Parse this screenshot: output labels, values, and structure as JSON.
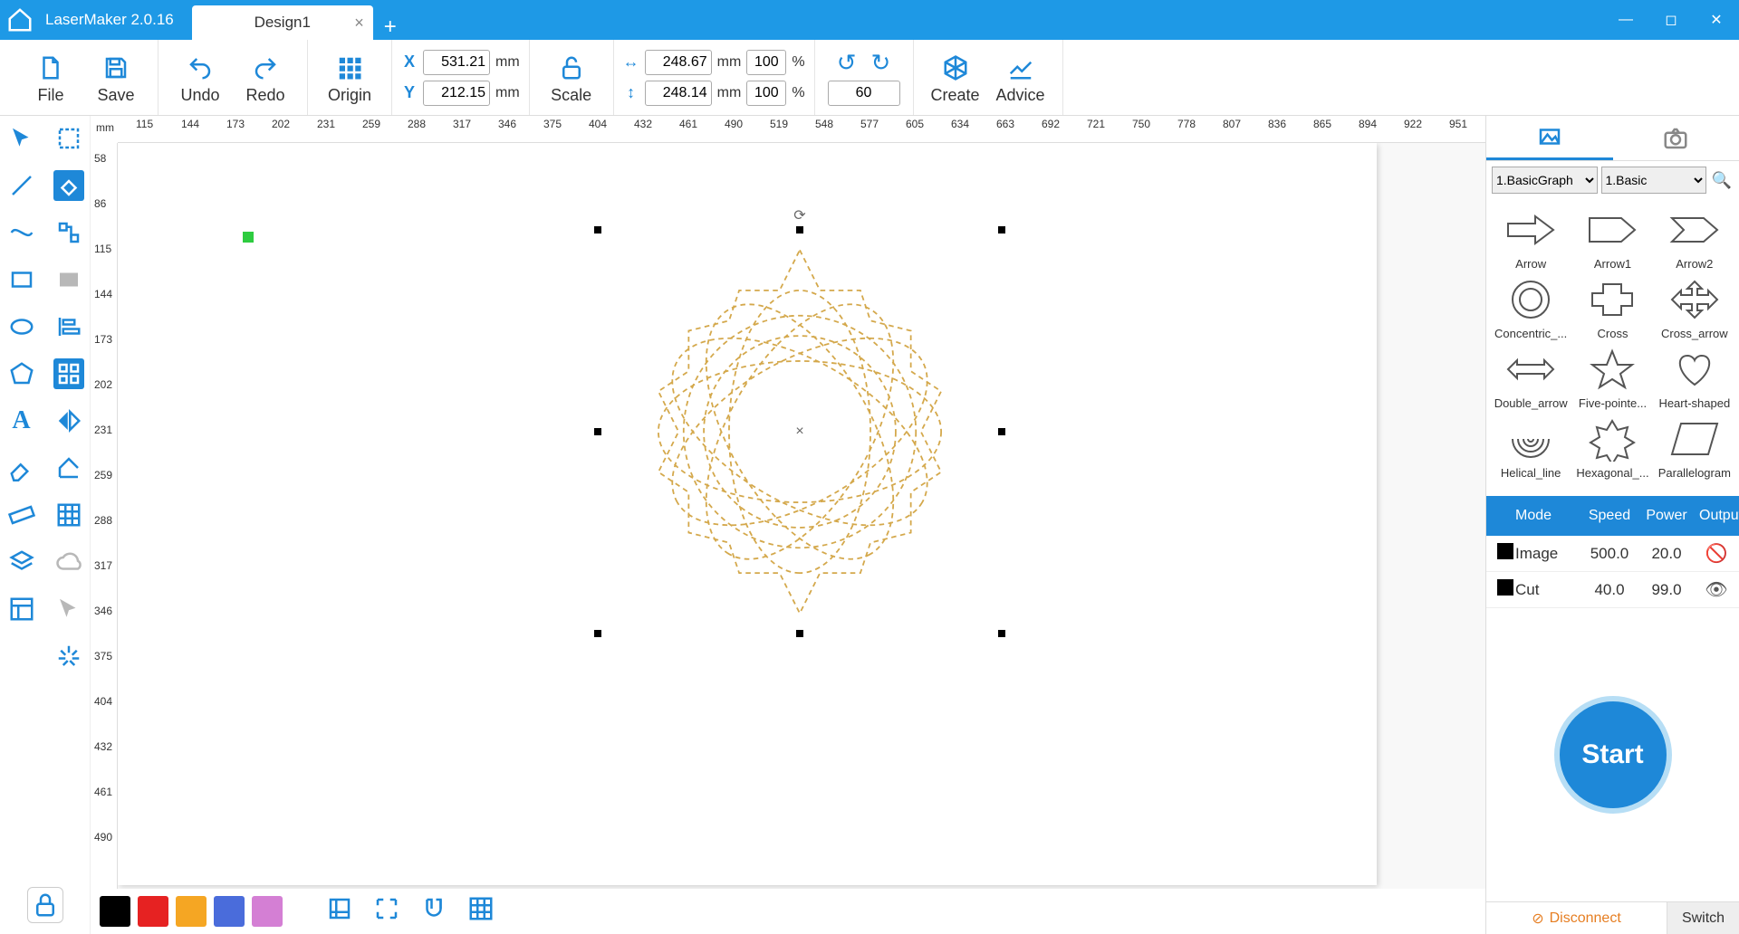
{
  "app": {
    "name": "LaserMaker 2.0.16",
    "tab": "Design1"
  },
  "toolbar": {
    "file": "File",
    "save": "Save",
    "undo": "Undo",
    "redo": "Redo",
    "origin": "Origin",
    "scale": "Scale",
    "create": "Create",
    "advice": "Advice",
    "x": "531.21",
    "y": "212.15",
    "w": "248.67",
    "h": "248.14",
    "sx": "100",
    "sy": "100",
    "rot": "60",
    "unit_mm": "mm",
    "unit_pct": "%",
    "X": "X",
    "Y": "Y"
  },
  "ruler": {
    "h_start": 115,
    "h_step": 39.27,
    "h_labels": [
      115,
      144,
      173,
      202,
      231,
      259,
      288,
      317,
      346,
      375,
      404,
      432,
      461,
      490,
      519,
      548,
      577,
      605,
      634,
      663,
      692,
      721,
      750,
      778,
      807,
      836,
      865,
      894,
      922,
      951
    ],
    "v_labels": [
      58,
      86,
      115,
      144,
      173,
      202,
      231,
      259,
      288,
      317,
      346,
      375,
      404,
      432,
      461,
      490
    ],
    "mm": "mm"
  },
  "right": {
    "cat1": "1.BasicGraph",
    "cat2": "1.Basic",
    "shapes": [
      "Arrow",
      "Arrow1",
      "Arrow2",
      "Concentric_...",
      "Cross",
      "Cross_arrow",
      "Double_arrow",
      "Five-pointe...",
      "Heart-shaped",
      "Helical_line",
      "Hexagonal_...",
      "Parallelogram"
    ],
    "hdr_mode": "Mode",
    "hdr_speed": "Speed",
    "hdr_power": "Power",
    "hdr_output": "Output",
    "rows": [
      {
        "mode": "Image",
        "speed": "500.0",
        "power": "20.0",
        "visible": false
      },
      {
        "mode": "Cut",
        "speed": "40.0",
        "power": "99.0",
        "visible": true
      }
    ],
    "start": "Start",
    "disconnect": "Disconnect",
    "switch": "Switch"
  },
  "colors": [
    "#000000",
    "#e62222",
    "#f5a623",
    "#4a6cdb",
    "#d47fd4"
  ]
}
